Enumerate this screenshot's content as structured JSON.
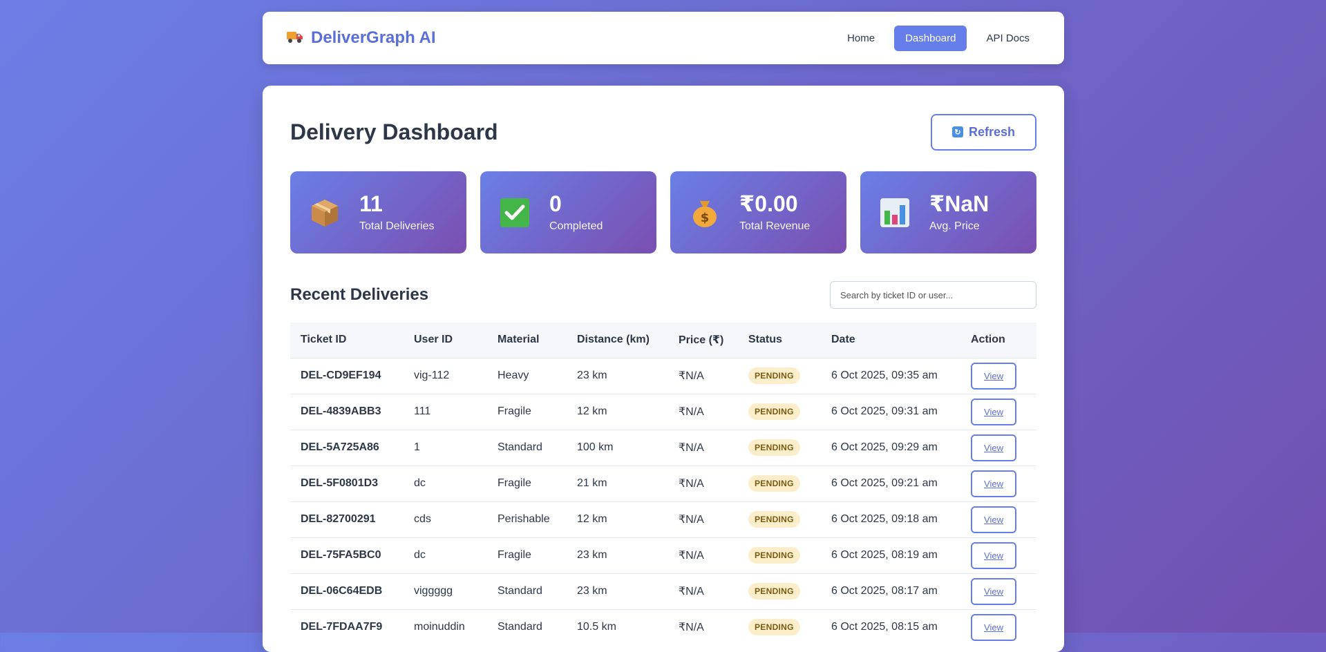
{
  "nav": {
    "brand": "DeliverGraph AI",
    "links": [
      {
        "label": "Home",
        "active": false
      },
      {
        "label": "Dashboard",
        "active": true
      },
      {
        "label": "API Docs",
        "active": false
      }
    ]
  },
  "dashboard": {
    "title": "Delivery Dashboard",
    "refresh_label": "Refresh"
  },
  "stats": [
    {
      "icon": "package-icon",
      "value": "11",
      "label": "Total Deliveries"
    },
    {
      "icon": "check-icon",
      "value": "0",
      "label": "Completed"
    },
    {
      "icon": "money-bag-icon",
      "value": "₹0.00",
      "label": "Total Revenue"
    },
    {
      "icon": "bar-chart-icon",
      "value": "₹NaN",
      "label": "Avg. Price"
    }
  ],
  "recent": {
    "title": "Recent Deliveries",
    "search_placeholder": "Search by ticket ID or user..."
  },
  "table": {
    "columns": [
      "Ticket ID",
      "User ID",
      "Material",
      "Distance (km)",
      "Price (₹)",
      "Status",
      "Date",
      "Action"
    ],
    "rows": [
      {
        "ticket": "DEL-CD9EF194",
        "user": "vig-112",
        "material": "Heavy",
        "distance": "23 km",
        "price": "₹N/A",
        "status": "PENDING",
        "date": "6 Oct 2025, 09:35 am",
        "action": "View"
      },
      {
        "ticket": "DEL-4839ABB3",
        "user": "111",
        "material": "Fragile",
        "distance": "12 km",
        "price": "₹N/A",
        "status": "PENDING",
        "date": "6 Oct 2025, 09:31 am",
        "action": "View"
      },
      {
        "ticket": "DEL-5A725A86",
        "user": "1",
        "material": "Standard",
        "distance": "100 km",
        "price": "₹N/A",
        "status": "PENDING",
        "date": "6 Oct 2025, 09:29 am",
        "action": "View"
      },
      {
        "ticket": "DEL-5F0801D3",
        "user": "dc",
        "material": "Fragile",
        "distance": "21 km",
        "price": "₹N/A",
        "status": "PENDING",
        "date": "6 Oct 2025, 09:21 am",
        "action": "View"
      },
      {
        "ticket": "DEL-82700291",
        "user": "cds",
        "material": "Perishable",
        "distance": "12 km",
        "price": "₹N/A",
        "status": "PENDING",
        "date": "6 Oct 2025, 09:18 am",
        "action": "View"
      },
      {
        "ticket": "DEL-75FA5BC0",
        "user": "dc",
        "material": "Fragile",
        "distance": "23 km",
        "price": "₹N/A",
        "status": "PENDING",
        "date": "6 Oct 2025, 08:19 am",
        "action": "View"
      },
      {
        "ticket": "DEL-06C64EDB",
        "user": "viggggg",
        "material": "Standard",
        "distance": "23 km",
        "price": "₹N/A",
        "status": "PENDING",
        "date": "6 Oct 2025, 08:17 am",
        "action": "View"
      },
      {
        "ticket": "DEL-7FDAA7F9",
        "user": "moinuddin",
        "material": "Standard",
        "distance": "10.5 km",
        "price": "₹N/A",
        "status": "PENDING",
        "date": "6 Oct 2025, 08:15 am",
        "action": "View"
      }
    ]
  }
}
